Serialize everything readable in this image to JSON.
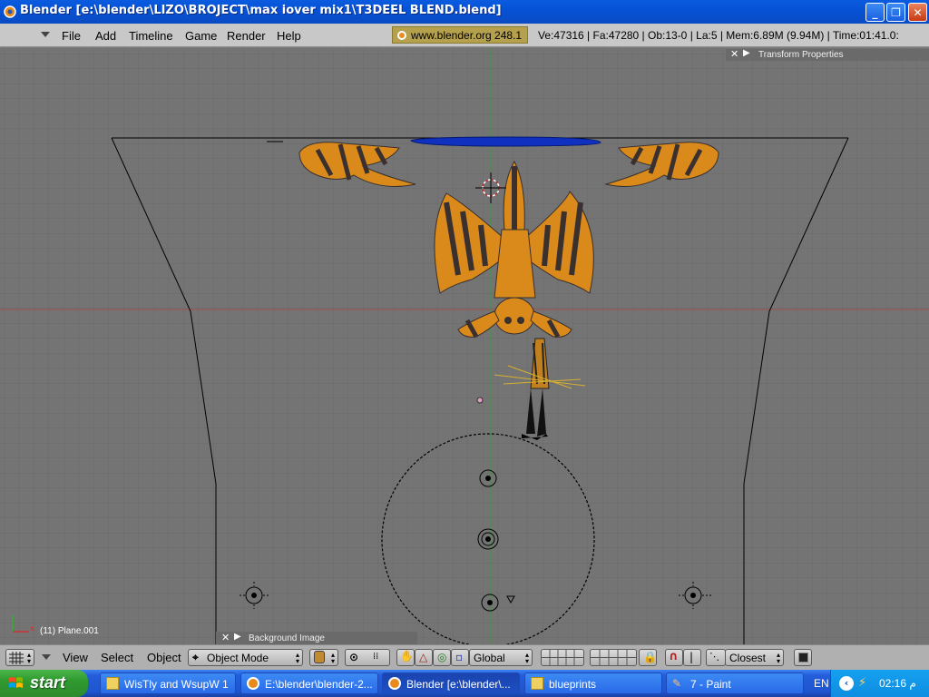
{
  "window": {
    "title": "Blender [e:\\blender\\LIZO\\BROJECT\\max iover mix1\\T3DEEL BLEND.blend]"
  },
  "menu": {
    "items": [
      "File",
      "Add",
      "Timeline",
      "Game",
      "Render",
      "Help"
    ]
  },
  "info": {
    "url_version": "www.blender.org 248.1",
    "stats": "Ve:47316 | Fa:47280 | Ob:13-0 | La:5  | Mem:6.89M (9.94M)  | Time:01:41.0:"
  },
  "viewport": {
    "transform_panel": "Transform Properties",
    "object_label": "(11) Plane.001",
    "background_panel": "Background Image"
  },
  "toolbar": {
    "view": "View",
    "select": "Select",
    "object": "Object",
    "mode": "Object Mode",
    "orientation": "Global",
    "snap": "Closest"
  },
  "taskbar": {
    "start": "start",
    "tasks": [
      {
        "label": "WisTly and WsupW 1",
        "icon": "folder-icon",
        "active": false
      },
      {
        "label": "E:\\blender\\blender-2...",
        "icon": "blender-icon",
        "active": false
      },
      {
        "label": "Blender [e:\\blender\\...",
        "icon": "blender-icon",
        "active": true
      },
      {
        "label": "blueprints",
        "icon": "folder-icon",
        "active": false
      },
      {
        "label": "7 - Paint",
        "icon": "paint-icon",
        "active": false
      }
    ],
    "language": "EN",
    "clock": "02:16 م"
  },
  "colors": {
    "viewport_bg": "#747474",
    "model_orange": "#d98a1a",
    "model_dark": "#3a3030",
    "accent_blue": "#1030c0"
  }
}
